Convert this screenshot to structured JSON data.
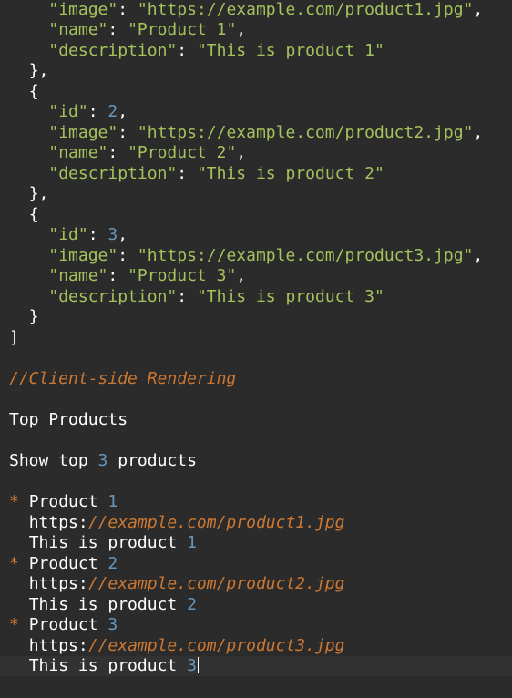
{
  "json_lines": {
    "l1_key": "\"image\"",
    "l1_val": "\"https://example.com/product1.jpg\"",
    "l2_key": "\"name\"",
    "l2_val": "\"Product 1\"",
    "l3_key": "\"description\"",
    "l3_val": "\"This is product 1\"",
    "close_obj1": "},",
    "open_obj2": "{",
    "l6_key": "\"id\"",
    "l6_val": "2",
    "l7_key": "\"image\"",
    "l7_val": "\"https://example.com/product2.jpg\"",
    "l8_key": "\"name\"",
    "l8_val": "\"Product 2\"",
    "l9_key": "\"description\"",
    "l9_val": "\"This is product 2\"",
    "close_obj2": "},",
    "open_obj3": "{",
    "l12_key": "\"id\"",
    "l12_val": "3",
    "l13_key": "\"image\"",
    "l13_val": "\"https://example.com/product3.jpg\"",
    "l14_key": "\"name\"",
    "l14_val": "\"Product 3\"",
    "l15_key": "\"description\"",
    "l15_val": "\"This is product 3\"",
    "close_obj3": "}",
    "close_array": "]"
  },
  "comment": "//Client-side Rendering",
  "heading": "Top Products",
  "show_top": {
    "prefix": "Show top ",
    "count": "3",
    "suffix": " products"
  },
  "products": [
    {
      "bullet": "*",
      "name_prefix": "Product ",
      "name_num": "1",
      "url_scheme": "https:",
      "url_rest": "//example.com/product1.jpg",
      "desc_prefix": "This is product ",
      "desc_num": "1"
    },
    {
      "bullet": "*",
      "name_prefix": "Product ",
      "name_num": "2",
      "url_scheme": "https:",
      "url_rest": "//example.com/product2.jpg",
      "desc_prefix": "This is product ",
      "desc_num": "2"
    },
    {
      "bullet": "*",
      "name_prefix": "Product ",
      "name_num": "3",
      "url_scheme": "https:",
      "url_rest": "//example.com/product3.jpg",
      "desc_prefix": "This is product ",
      "desc_num": "3"
    }
  ],
  "colors": {
    "background": "#2b2b2b",
    "string": "#a5c25c",
    "number": "#6897bb",
    "comment": "#cc7832",
    "text": "#ffffff"
  }
}
